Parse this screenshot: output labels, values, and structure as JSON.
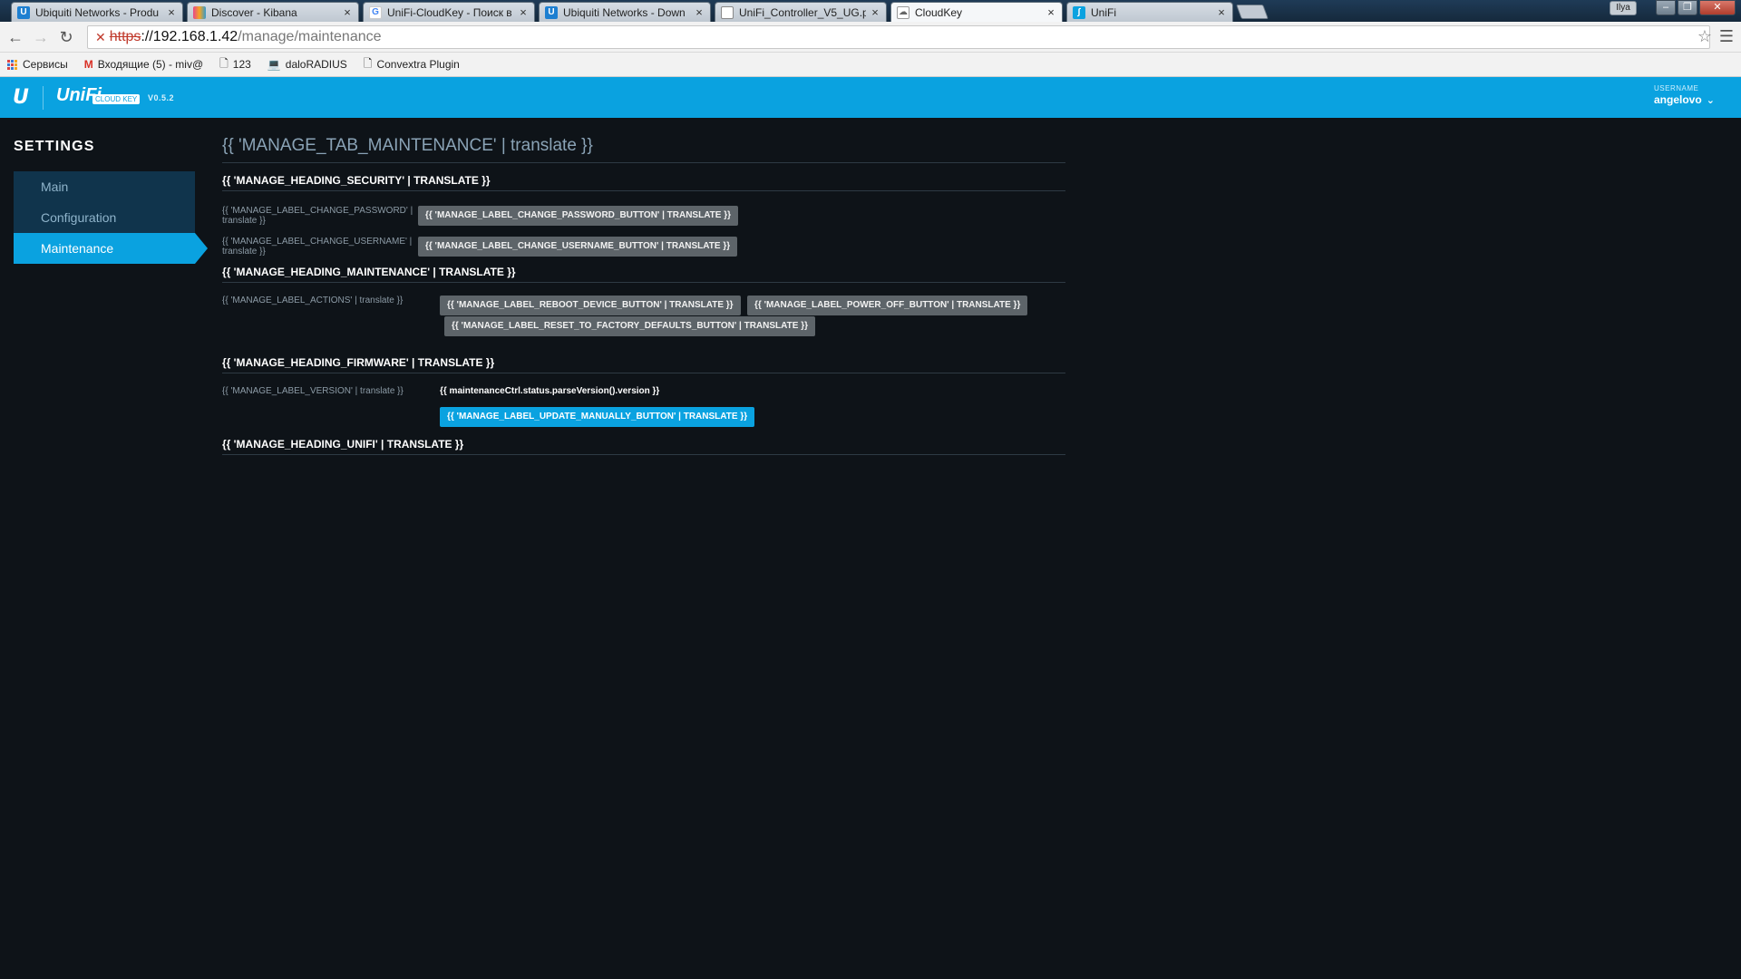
{
  "browser": {
    "tabs": [
      {
        "title": "Ubiquiti Networks - Produ",
        "favicon": "ubiquiti-u-icon",
        "active": false
      },
      {
        "title": "Discover - Kibana",
        "favicon": "kibana-icon",
        "active": false
      },
      {
        "title": "UniFi-CloudKey - Поиск в",
        "favicon": "google-g-icon",
        "active": false
      },
      {
        "title": "Ubiquiti Networks - Down",
        "favicon": "ubiquiti-u-icon",
        "active": false
      },
      {
        "title": "UniFi_Controller_V5_UG.p",
        "favicon": "document-icon",
        "active": false
      },
      {
        "title": "CloudKey",
        "favicon": "cloud-icon",
        "active": true
      },
      {
        "title": "UniFi",
        "favicon": "unifi-icon",
        "active": false
      }
    ],
    "window_user": "Ilya",
    "address": {
      "scheme": "https",
      "host": "://192.168.1.42",
      "path": "/manage/maintenance"
    },
    "bookmarks": [
      {
        "label": "Сервисы",
        "icon": "apps-icon"
      },
      {
        "label": "Входящие (5) - miv@",
        "icon": "gmail-icon"
      },
      {
        "label": "123",
        "icon": "page-icon"
      },
      {
        "label": "daloRADIUS",
        "icon": "laptop-icon"
      },
      {
        "label": "Convextra Plugin",
        "icon": "page-icon"
      }
    ]
  },
  "app": {
    "brand": "UniFi",
    "brand_tag": "CLOUD KEY",
    "version": "V0.5.2",
    "accent": "#0aa2e0",
    "user": {
      "caption": "USERNAME",
      "name": "angelovo"
    }
  },
  "sidebar": {
    "title": "SETTINGS",
    "items": [
      {
        "label": "Main",
        "active": false
      },
      {
        "label": "Configuration",
        "active": false
      },
      {
        "label": "Maintenance",
        "active": true
      }
    ]
  },
  "main": {
    "title": "{{ 'MANAGE_TAB_MAINTENANCE' | translate }}",
    "security": {
      "heading": "{{ 'MANAGE_HEADING_SECURITY' | TRANSLATE }}",
      "change_password_label": "{{ 'MANAGE_LABEL_CHANGE_PASSWORD' | translate }}",
      "change_password_button": "{{ 'MANAGE_LABEL_CHANGE_PASSWORD_BUTTON' | TRANSLATE }}",
      "change_username_label": "{{ 'MANAGE_LABEL_CHANGE_USERNAME' | translate }}",
      "change_username_button": "{{ 'MANAGE_LABEL_CHANGE_USERNAME_BUTTON' | TRANSLATE }}"
    },
    "maintenance": {
      "heading": "{{ 'MANAGE_HEADING_MAINTENANCE' | TRANSLATE }}",
      "actions_label": "{{ 'MANAGE_LABEL_ACTIONS' | translate }}",
      "reboot_button": "{{ 'MANAGE_LABEL_REBOOT_DEVICE_BUTTON' | TRANSLATE }}",
      "power_off_button": "{{ 'MANAGE_LABEL_POWER_OFF_BUTTON' | TRANSLATE }}",
      "reset_button": "{{ 'MANAGE_LABEL_RESET_TO_FACTORY_DEFAULTS_BUTTON' | TRANSLATE }}"
    },
    "firmware": {
      "heading": "{{ 'MANAGE_HEADING_FIRMWARE' | TRANSLATE }}",
      "version_label": "{{ 'MANAGE_LABEL_VERSION' | translate }}",
      "version_value": "{{ maintenanceCtrl.status.parseVersion().version }}",
      "update_button": "{{ 'MANAGE_LABEL_UPDATE_MANUALLY_BUTTON' | TRANSLATE }}"
    },
    "unifi": {
      "heading": "{{ 'MANAGE_HEADING_UNIFI' | TRANSLATE }}"
    }
  }
}
